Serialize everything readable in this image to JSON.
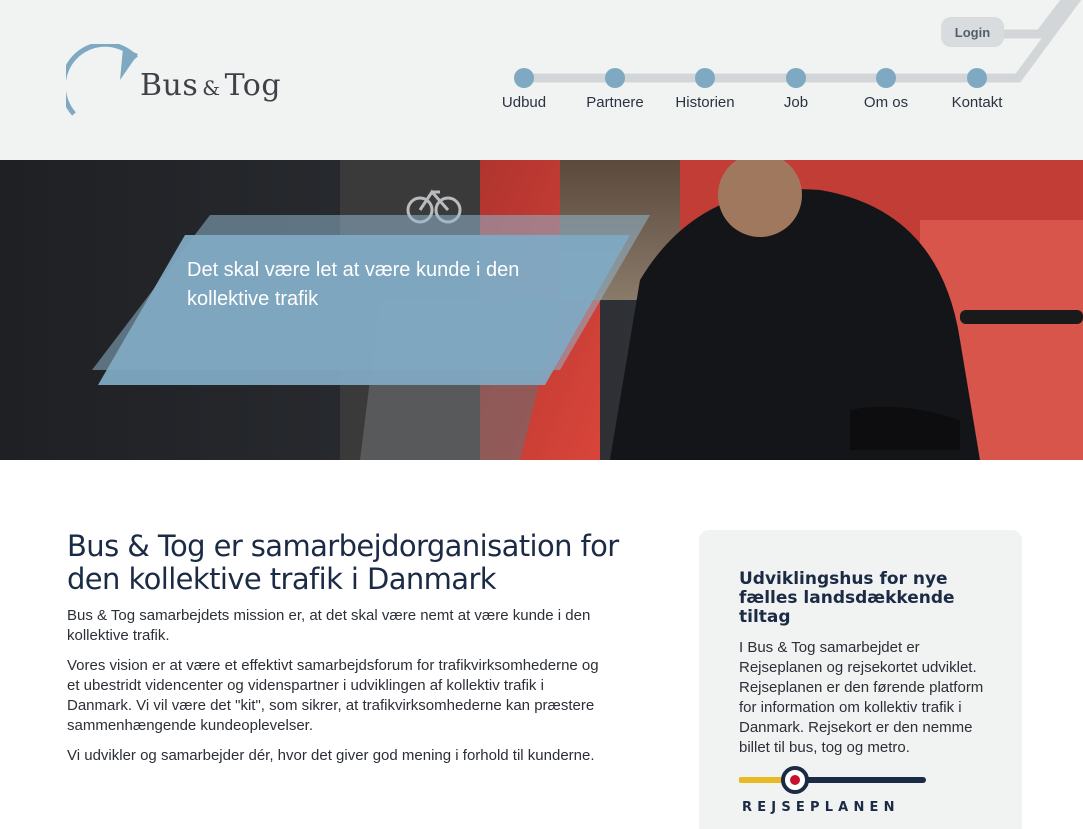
{
  "header": {
    "logo": {
      "brand_left": "Bus",
      "brand_amp": "&",
      "brand_right": "Tog"
    },
    "login_label": "Login",
    "nav": [
      {
        "label": "Udbud"
      },
      {
        "label": "Partnere"
      },
      {
        "label": "Historien"
      },
      {
        "label": "Job"
      },
      {
        "label": "Om os"
      },
      {
        "label": "Kontakt"
      }
    ]
  },
  "hero": {
    "headline": "Det skal være let at være kunde i den kollektive trafik"
  },
  "main": {
    "title": "Bus & Tog er samarbejdorganisation for den kollektive trafik i Danmark",
    "paragraphs": [
      "Bus & Tog samarbejdets mission er, at det skal være nemt at være kunde i den kollektive trafik.",
      "Vores vision er at være et effektivt samarbejdsforum for trafikvirksomhederne og et ubestridt videncenter og videnspartner i udviklingen af kollektiv trafik i Danmark.  Vi vil være det \"kit\", som sikrer, at trafikvirksomhederne kan præstere sammenhængende kundeoplevelser.",
      "Vi udvikler og samarbejder dér, hvor det giver god mening i forhold til kunderne."
    ]
  },
  "sidebar": {
    "title": "Udviklingshus for nye fælles landsdækkende tiltag",
    "text": "I Bus & Tog samarbejdet er Rejseplanen og rejsekortet udviklet. Rejseplanen er den førende platform for information om kollektiv trafik i Danmark. Rejsekort er den nemme billet til bus, tog og metro.",
    "rejseplanen_word": "REJSEPLANEN"
  },
  "colors": {
    "header_bg": "#f1f2f2",
    "nav_dot": "#7fa9c2",
    "track": "#d3d6d9",
    "hero_box": "#7fa9c2",
    "heading": "#1c2b45",
    "rp_yellow": "#e8b923",
    "rp_red": "#c8102e",
    "rp_navy": "#1c2b45"
  }
}
